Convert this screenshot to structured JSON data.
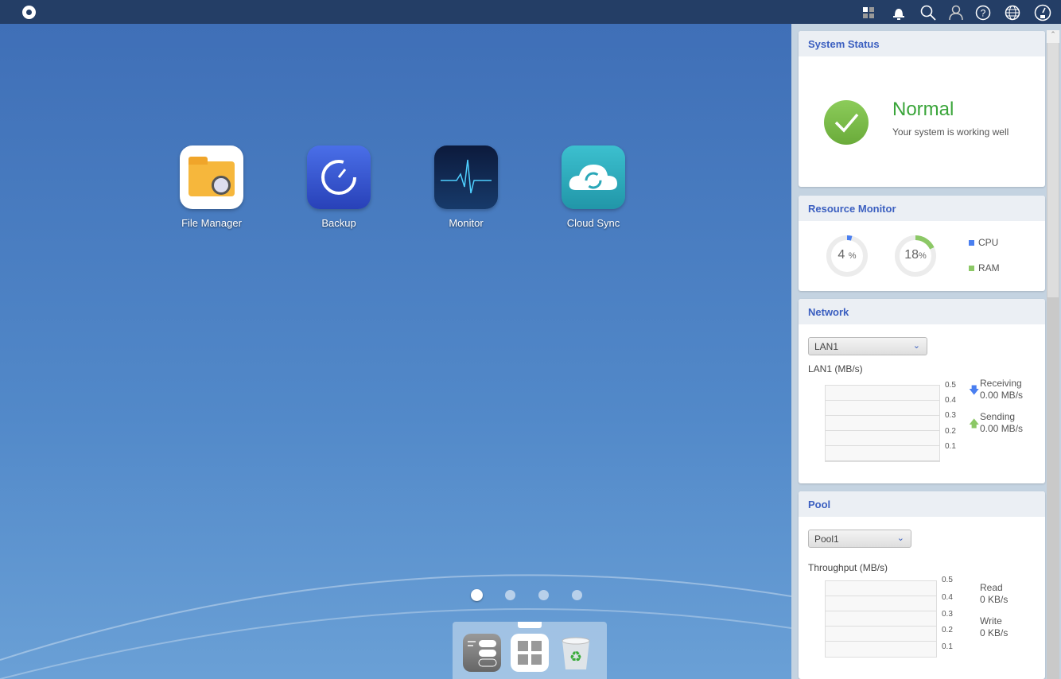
{
  "topbar": {
    "icons": [
      "apps-icon",
      "bell-icon",
      "search-icon",
      "user-icon",
      "help-icon",
      "globe-icon",
      "dashboard-icon"
    ]
  },
  "desktop": {
    "apps": [
      {
        "label": "File Manager"
      },
      {
        "label": "Backup"
      },
      {
        "label": "Monitor"
      },
      {
        "label": "Cloud Sync"
      }
    ],
    "pages": 4,
    "active_page": 1
  },
  "dock": {
    "items": [
      "control-panel-icon",
      "app-center-icon",
      "recycle-bin-icon"
    ]
  },
  "system_status": {
    "title": "System Status",
    "status": "Normal",
    "message": "Your system is working well",
    "color": "#3aa53a"
  },
  "resource_monitor": {
    "title": "Resource Monitor",
    "cpu": {
      "value": "4",
      "unit": "%",
      "fraction": 0.04,
      "color": "#4a7ff0"
    },
    "ram": {
      "value": "18",
      "unit": "%",
      "fraction": 0.18,
      "color": "#8cc866"
    },
    "legend_cpu": "CPU",
    "legend_ram": "RAM"
  },
  "network": {
    "title": "Network",
    "select": "LAN1",
    "chart_label": "LAN1 (MB/s)",
    "ticks": [
      "0.5",
      "0.4",
      "0.3",
      "0.2",
      "0.1"
    ],
    "receiving_label": "Receiving",
    "receiving_value": "0.00 MB/s",
    "sending_label": "Sending",
    "sending_value": "0.00 MB/s"
  },
  "pool": {
    "title": "Pool",
    "select": "Pool1",
    "chart_label": "Throughput (MB/s)",
    "ticks": [
      "0.5",
      "0.4",
      "0.3",
      "0.2",
      "0.1"
    ],
    "read_label": "Read",
    "read_value": "0 KB/s",
    "write_label": "Write",
    "write_value": "0 KB/s"
  }
}
